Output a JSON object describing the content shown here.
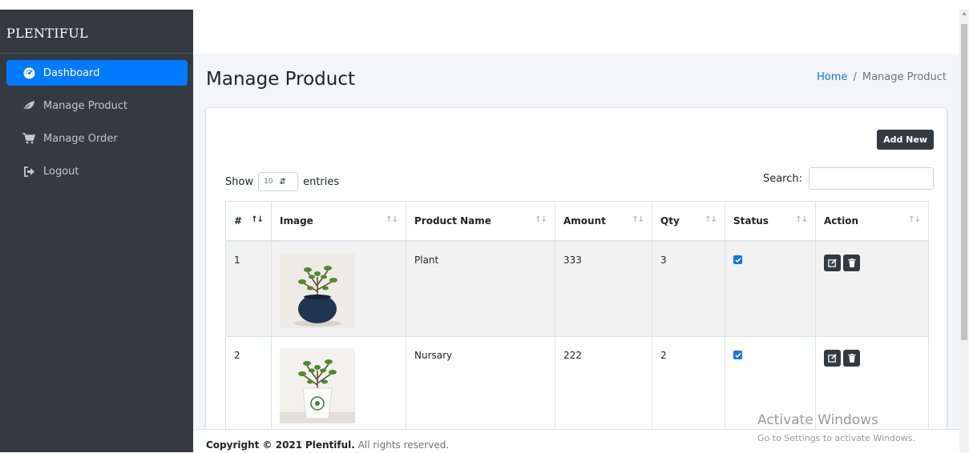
{
  "brand": "PLENTIFUL",
  "sidebar": {
    "items": [
      {
        "label": "Dashboard",
        "icon": "tachometer-icon",
        "active": true
      },
      {
        "label": "Manage Product",
        "icon": "leaf-icon",
        "active": false
      },
      {
        "label": "Manage Order",
        "icon": "cart-icon",
        "active": false
      },
      {
        "label": "Logout",
        "icon": "sign-out-icon",
        "active": false
      }
    ]
  },
  "header": {
    "title": "Manage Product",
    "breadcrumb": {
      "home": "Home",
      "separator": "/",
      "current": "Manage Product"
    }
  },
  "card": {
    "add_new_label": "Add New",
    "length": {
      "prefix": "Show",
      "value": "10",
      "suffix": "entries"
    },
    "search_label": "Search:",
    "search_value": ""
  },
  "table": {
    "columns": [
      "#",
      "Image",
      "Product Name",
      "Amount",
      "Qty",
      "Status",
      "Action"
    ],
    "rows": [
      {
        "index": "1",
        "image": "plant-in-blue-pot",
        "name": "Plant",
        "amount": "333",
        "qty": "3",
        "status": true
      },
      {
        "index": "2",
        "image": "plant-in-white-pot",
        "name": "Nursary",
        "amount": "222",
        "qty": "2",
        "status": true
      }
    ]
  },
  "footer": {
    "copyright_prefix": "Copyright © 2021",
    "brand": "Plentiful.",
    "suffix": "All rights reserved."
  },
  "watermark": {
    "line1": "Activate Windows",
    "line2": "Go to Settings to activate Windows."
  },
  "colors": {
    "sidebar": "#343a40",
    "active": "#007bff",
    "content_bg": "#f4f6f9",
    "link": "#007bff",
    "checkbox": "#1a73e8"
  }
}
